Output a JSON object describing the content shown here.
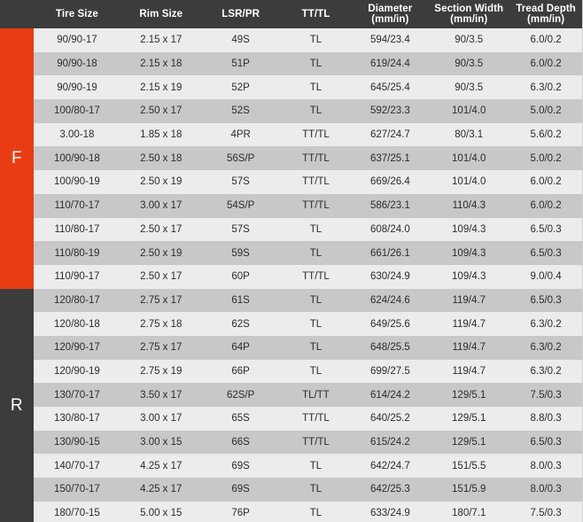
{
  "table": {
    "columns": [
      {
        "id": "tire_size",
        "label": "Tire Size",
        "unit": ""
      },
      {
        "id": "rim_size",
        "label": "Rim Size",
        "unit": ""
      },
      {
        "id": "lsr_pr",
        "label": "LSR/PR",
        "unit": ""
      },
      {
        "id": "tt_tl",
        "label": "TT/TL",
        "unit": ""
      },
      {
        "id": "diameter",
        "label": "Diameter",
        "unit": "(mm/in)"
      },
      {
        "id": "section_width",
        "label": "Section Width",
        "unit": "(mm/in)"
      },
      {
        "id": "tread_depth",
        "label": "Tread Depth",
        "unit": "(mm/in)"
      }
    ],
    "groups": [
      {
        "id": "front",
        "label": "F",
        "color": "#ea3c12"
      },
      {
        "id": "rear",
        "label": "R",
        "color": "#3c3c3c"
      }
    ],
    "colors": {
      "header_bg": "#3c3c3c",
      "header_text": "#ffffff",
      "row_odd": "#ececec",
      "row_even": "#c8c8c8",
      "text": "#2b2b2b",
      "front_accent": "#ea3c12",
      "rear_accent": "#3c3c3c"
    },
    "front_rows": [
      {
        "tire_size": "90/90-17",
        "rim_size": "2.15 x 17",
        "lsr_pr": "49S",
        "tt_tl": "TL",
        "diameter": "594/23.4",
        "section_width": "90/3.5",
        "tread_depth": "6.0/0.2"
      },
      {
        "tire_size": "90/90-18",
        "rim_size": "2.15 x 18",
        "lsr_pr": "51P",
        "tt_tl": "TL",
        "diameter": "619/24.4",
        "section_width": "90/3.5",
        "tread_depth": "6.0/0.2"
      },
      {
        "tire_size": "90/90-19",
        "rim_size": "2.15 x 19",
        "lsr_pr": "52P",
        "tt_tl": "TL",
        "diameter": "645/25.4",
        "section_width": "90/3.5",
        "tread_depth": "6.3/0.2"
      },
      {
        "tire_size": "100/80-17",
        "rim_size": "2.50 x 17",
        "lsr_pr": "52S",
        "tt_tl": "TL",
        "diameter": "592/23.3",
        "section_width": "101/4.0",
        "tread_depth": "5.0/0.2"
      },
      {
        "tire_size": "3.00-18",
        "rim_size": "1.85 x 18",
        "lsr_pr": "4PR",
        "tt_tl": "TT/TL",
        "diameter": "627/24.7",
        "section_width": "80/3.1",
        "tread_depth": "5.6/0.2"
      },
      {
        "tire_size": "100/90-18",
        "rim_size": "2.50 x 18",
        "lsr_pr": "56S/P",
        "tt_tl": "TT/TL",
        "diameter": "637/25.1",
        "section_width": "101/4.0",
        "tread_depth": "5.0/0.2"
      },
      {
        "tire_size": "100/90-19",
        "rim_size": "2.50 x 19",
        "lsr_pr": "57S",
        "tt_tl": "TT/TL",
        "diameter": "669/26.4",
        "section_width": "101/4.0",
        "tread_depth": "6.0/0.2"
      },
      {
        "tire_size": "110/70-17",
        "rim_size": "3.00 x 17",
        "lsr_pr": "54S/P",
        "tt_tl": "TT/TL",
        "diameter": "586/23.1",
        "section_width": "110/4.3",
        "tread_depth": "6.0/0.2"
      },
      {
        "tire_size": "110/80-17",
        "rim_size": "2.50 x 17",
        "lsr_pr": "57S",
        "tt_tl": "TL",
        "diameter": "608/24.0",
        "section_width": "109/4.3",
        "tread_depth": "6.5/0.3"
      },
      {
        "tire_size": "110/80-19",
        "rim_size": "2.50 x 19",
        "lsr_pr": "59S",
        "tt_tl": "TL",
        "diameter": "661/26.1",
        "section_width": "109/4.3",
        "tread_depth": "6.5/0.3"
      },
      {
        "tire_size": "110/90-17",
        "rim_size": "2.50 x 17",
        "lsr_pr": "60P",
        "tt_tl": "TT/TL",
        "diameter": "630/24.9",
        "section_width": "109/4.3",
        "tread_depth": "9.0/0.4"
      }
    ],
    "rear_rows": [
      {
        "tire_size": "120/80-17",
        "rim_size": "2.75 x 17",
        "lsr_pr": "61S",
        "tt_tl": "TL",
        "diameter": "624/24.6",
        "section_width": "119/4.7",
        "tread_depth": "6.5/0.3"
      },
      {
        "tire_size": "120/80-18",
        "rim_size": "2.75 x 18",
        "lsr_pr": "62S",
        "tt_tl": "TL",
        "diameter": "649/25.6",
        "section_width": "119/4.7",
        "tread_depth": "6.3/0.2"
      },
      {
        "tire_size": "120/90-17",
        "rim_size": "2.75 x 17",
        "lsr_pr": "64P",
        "tt_tl": "TL",
        "diameter": "648/25.5",
        "section_width": "119/4.7",
        "tread_depth": "6.3/0.2"
      },
      {
        "tire_size": "120/90-19",
        "rim_size": "2.75 x 19",
        "lsr_pr": "66P",
        "tt_tl": "TL",
        "diameter": "699/27.5",
        "section_width": "119/4.7",
        "tread_depth": "6.3/0.2"
      },
      {
        "tire_size": "130/70-17",
        "rim_size": "3.50 x 17",
        "lsr_pr": "62S/P",
        "tt_tl": "TL/TT",
        "diameter": "614/24.2",
        "section_width": "129/5.1",
        "tread_depth": "7.5/0.3"
      },
      {
        "tire_size": "130/80-17",
        "rim_size": "3.00 x 17",
        "lsr_pr": "65S",
        "tt_tl": "TT/TL",
        "diameter": "640/25.2",
        "section_width": "129/5.1",
        "tread_depth": "8.8/0.3"
      },
      {
        "tire_size": "130/90-15",
        "rim_size": "3.00 x 15",
        "lsr_pr": "66S",
        "tt_tl": "TT/TL",
        "diameter": "615/24.2",
        "section_width": "129/5.1",
        "tread_depth": "6.5/0.3"
      },
      {
        "tire_size": "140/70-17",
        "rim_size": "4.25 x 17",
        "lsr_pr": "69S",
        "tt_tl": "TL",
        "diameter": "642/24.7",
        "section_width": "151/5.5",
        "tread_depth": "8.0/0.3"
      },
      {
        "tire_size": "150/70-17",
        "rim_size": "4.25 x 17",
        "lsr_pr": "69S",
        "tt_tl": "TL",
        "diameter": "642/25.3",
        "section_width": "151/5.9",
        "tread_depth": "8.0/0.3"
      },
      {
        "tire_size": "180/70-15",
        "rim_size": "5.00 x 15",
        "lsr_pr": "76P",
        "tt_tl": "TL",
        "diameter": "633/24.9",
        "section_width": "180/7.1",
        "tread_depth": "7.5/0.3"
      }
    ]
  }
}
